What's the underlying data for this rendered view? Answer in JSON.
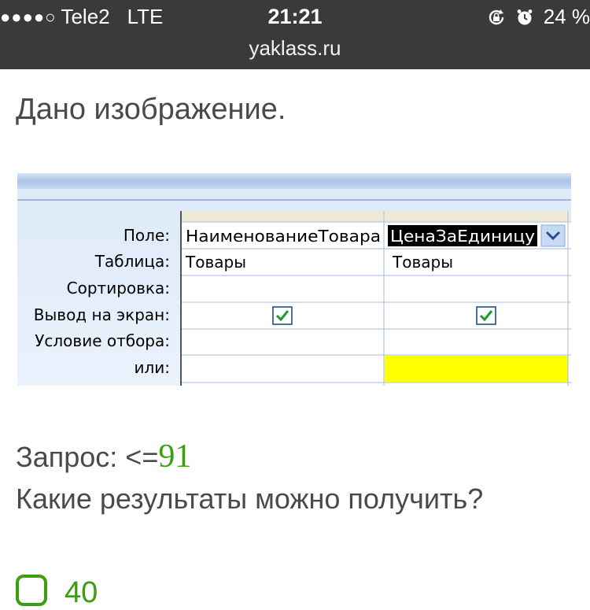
{
  "status_bar": {
    "signal": "●●●●○",
    "carrier": "Tele2",
    "network": "LTE",
    "time": "21:21",
    "battery": "24 %",
    "url": "yaklass.ru",
    "icons": [
      "rotation-lock-icon",
      "alarm-icon"
    ]
  },
  "task": {
    "intro": "Дано изображение.",
    "query_label": "Запрос: <=",
    "query_value": "91",
    "question": "Какие результаты можно получить?"
  },
  "design_grid": {
    "row_labels": [
      "Поле:",
      "Таблица:",
      "Сортировка:",
      "Вывод на экран:",
      "Условие отбора:",
      "или:"
    ],
    "columns": [
      {
        "field": "НаименованиеТовара",
        "table": "Товары",
        "show": true,
        "selected": false
      },
      {
        "field": "ЦенаЗаЕдиницу",
        "table": "Товары",
        "show": true,
        "selected": true
      }
    ],
    "dropdown_icon": "chevron-down-icon",
    "highlight_color": "#ffff00"
  },
  "answers": [
    {
      "label": "40"
    }
  ],
  "colors": {
    "accent": "#3a9e0e",
    "status_bar": "#3a3a3a",
    "text": "#4a4a4a"
  }
}
